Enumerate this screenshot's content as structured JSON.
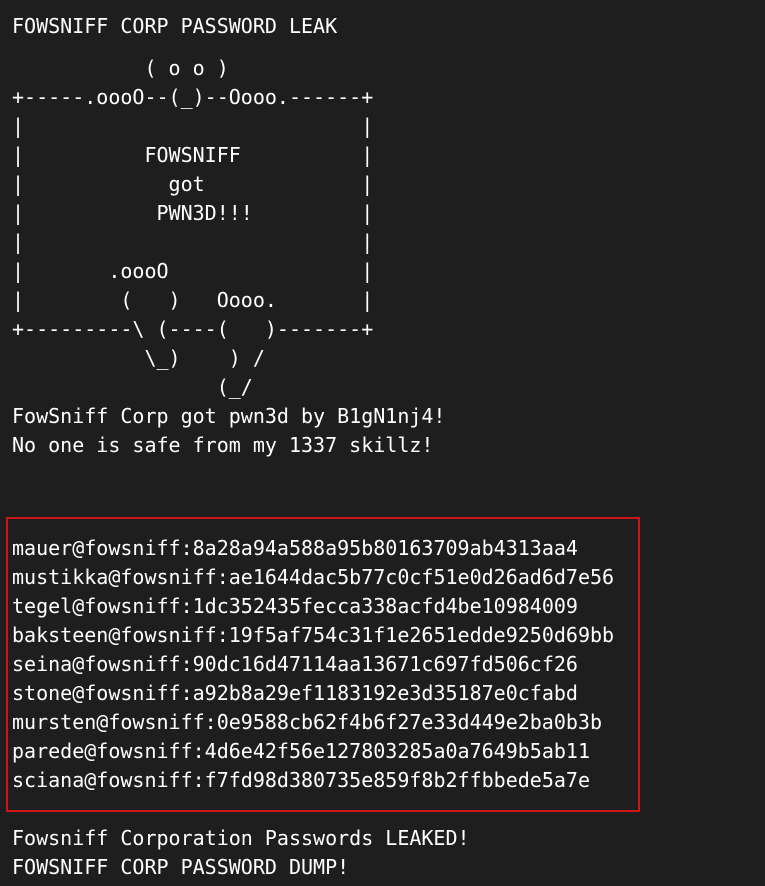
{
  "header_title": "FOWSNIFF CORP PASSWORD LEAK",
  "ascii_art": [
    "            ''~``",
    "           ( o o )",
    "+-----.oooO--(_)--Oooo.------+",
    "|                            |",
    "|          FOWSNIFF          |",
    "|            got             |",
    "|           PWN3D!!!         |",
    "|                            |",
    "|       .oooO                |",
    "|        (   )   Oooo.       |",
    "+---------\\ (----(   )-------+",
    "           \\_)    ) /",
    "                 (_/"
  ],
  "taunt_lines": [
    "FowSniff Corp got pwn3d by B1gN1nj4!",
    "No one is safe from my 1337 skillz!"
  ],
  "credentials": [
    {
      "user": "mauer@fowsniff",
      "hash": "8a28a94a588a95b80163709ab4313aa4"
    },
    {
      "user": "mustikka@fowsniff",
      "hash": "ae1644dac5b77c0cf51e0d26ad6d7e56"
    },
    {
      "user": "tegel@fowsniff",
      "hash": "1dc352435fecca338acfd4be10984009"
    },
    {
      "user": "baksteen@fowsniff",
      "hash": "19f5af754c31f1e2651edde9250d69bb"
    },
    {
      "user": "seina@fowsniff",
      "hash": "90dc16d47114aa13671c697fd506cf26"
    },
    {
      "user": "stone@fowsniff",
      "hash": "a92b8a29ef1183192e3d35187e0cfabd"
    },
    {
      "user": "mursten@fowsniff",
      "hash": "0e9588cb62f4b6f27e33d449e2ba0b3b"
    },
    {
      "user": "parede@fowsniff",
      "hash": "4d6e42f56e127803285a0a7649b5ab11"
    },
    {
      "user": "sciana@fowsniff",
      "hash": "f7fd98d380735e859f8b2ffbbede5a7e"
    }
  ],
  "footer_lines": [
    "Fowsniff Corporation Passwords LEAKED!",
    "FOWSNIFF CORP PASSWORD DUMP!"
  ],
  "colors": {
    "background": "#1e1e1e",
    "text": "#ffffff",
    "highlight_border": "#d0141a"
  }
}
